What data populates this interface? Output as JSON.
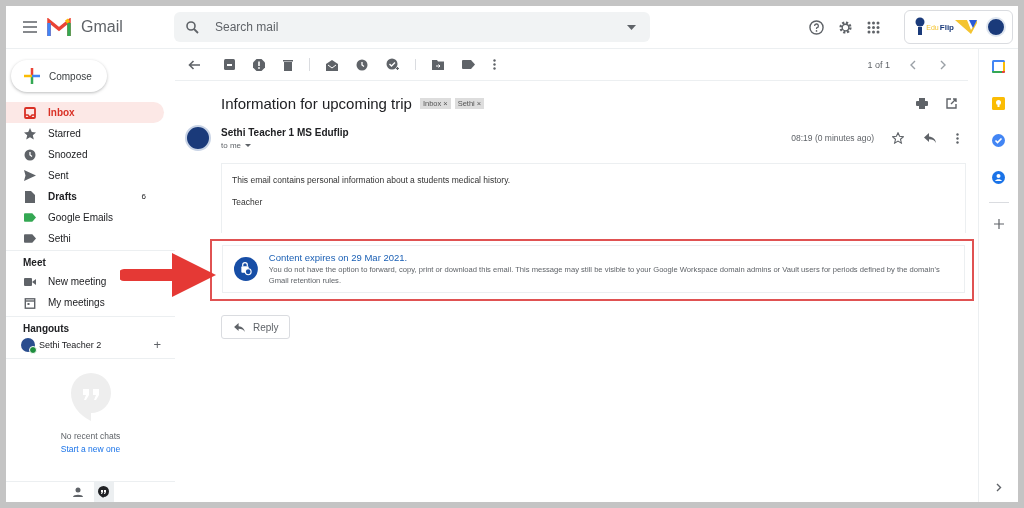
{
  "app": {
    "name": "Gmail"
  },
  "search": {
    "placeholder": "Search mail"
  },
  "account_logo": {
    "text_1": "Edu",
    "text_2": "Flip"
  },
  "compose": {
    "label": "Compose"
  },
  "nav": [
    {
      "label": "Inbox",
      "selected": true,
      "unread": true
    },
    {
      "label": "Starred",
      "selected": false,
      "unread": false
    },
    {
      "label": "Snoozed",
      "selected": false,
      "unread": false
    },
    {
      "label": "Sent",
      "selected": false,
      "unread": false
    },
    {
      "label": "Drafts",
      "count": "6",
      "selected": false,
      "unread": true
    },
    {
      "label": "Google Emails",
      "selected": false,
      "unread": false
    },
    {
      "label": "Sethi",
      "selected": false,
      "unread": false
    }
  ],
  "meet": {
    "title": "Meet",
    "items": [
      "New meeting",
      "My meetings"
    ]
  },
  "hangouts": {
    "title": "Hangouts",
    "contact": {
      "name": "Sethi Teacher 2",
      "online": true
    },
    "add": "+",
    "empty_text": "No recent chats",
    "start_link": "Start a new one"
  },
  "bottom_tabs": [
    {
      "selected": false
    },
    {
      "selected": true
    }
  ],
  "pager": "1 of 1",
  "message": {
    "subject": "Information for upcoming trip",
    "labels": [
      {
        "label": "Inbox",
        "remove": "×"
      },
      {
        "label": "Sethi",
        "remove": "×"
      }
    ],
    "sender": "Sethi Teacher 1 MS Eduflip",
    "recipient": "to me",
    "time": "08:19 (0 minutes ago)",
    "body": [
      "This email contains personal information about a students medical history.",
      "Teacher"
    ],
    "notice": {
      "title": "Content expires on 29 Mar 2021.",
      "text": "You do not have the option to forward, copy, print or download this email. This message may still be visible to your Google Workspace domain admins or Vault users for periods defined by the domain's Gmail retention rules."
    }
  },
  "reply_button": "Reply"
}
